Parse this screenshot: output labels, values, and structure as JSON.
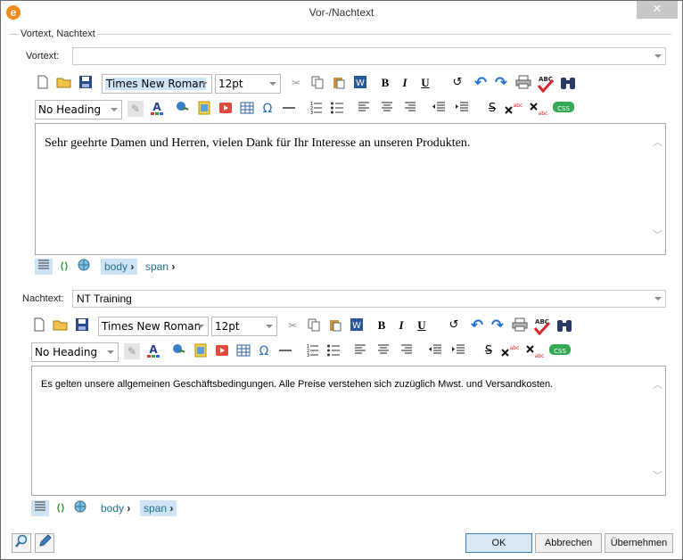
{
  "window": {
    "title": "Vor-/Nachtext",
    "app_icon": "e",
    "close_glyph": "✕"
  },
  "group": {
    "legend": "Vortext, Nachtext"
  },
  "vortext": {
    "label": "Vortext:",
    "value": "",
    "font": "Times New Roman",
    "size": "12pt",
    "heading": "No Heading",
    "content": "Sehr geehrte Damen und Herren, vielen Dank für Ihr Interesse an unseren Produkten.",
    "path": [
      "body",
      "span"
    ],
    "active_crumb": "body"
  },
  "nachtext": {
    "label": "Nachtext:",
    "value": "NT Training",
    "font": "Times New Roman",
    "size": "12pt",
    "heading": "No Heading",
    "content": "Es gelten unsere allgemeinen Geschäftsbedingungen. Alle Preise verstehen sich zuzüglich Mwst. und Versandkosten.",
    "path": [
      "body",
      "span"
    ],
    "active_crumb": "span"
  },
  "toolbar": {
    "bold": "B",
    "italic": "I",
    "underline": "U",
    "omega": "Ω",
    "css": "CSS",
    "spell": "ABC"
  },
  "footer": {
    "ok": "OK",
    "cancel": "Abbrechen",
    "apply": "Übernehmen"
  },
  "colors": {
    "accent": "#3c7fb1",
    "crumb_text": "#1f6f8f",
    "crumb_active_bg": "#cfe3f7",
    "app_icon": "#f08a1c"
  }
}
